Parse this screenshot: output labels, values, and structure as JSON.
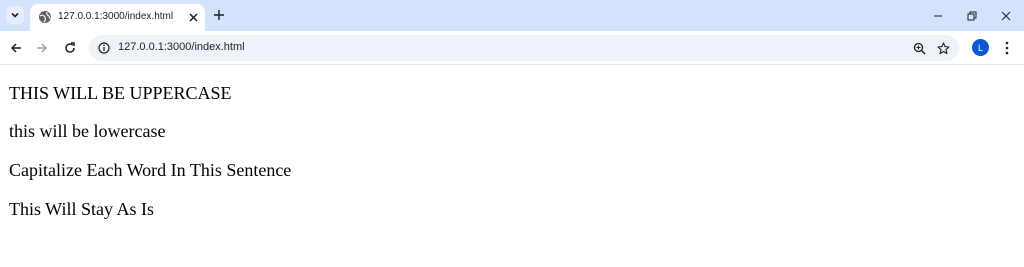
{
  "browser": {
    "tab": {
      "title": "127.0.0.1:3000/index.html"
    },
    "address_bar": {
      "url": "127.0.0.1:3000/index.html"
    },
    "profile": {
      "initial": "L",
      "color": "#0b57d0"
    },
    "tabbar_color": "#d3e3fd"
  },
  "page": {
    "paragraphs": [
      "THIS WILL BE UPPERCASE",
      "this will be lowercase",
      "Capitalize Each Word In This Sentence",
      "This Will Stay As Is"
    ]
  }
}
